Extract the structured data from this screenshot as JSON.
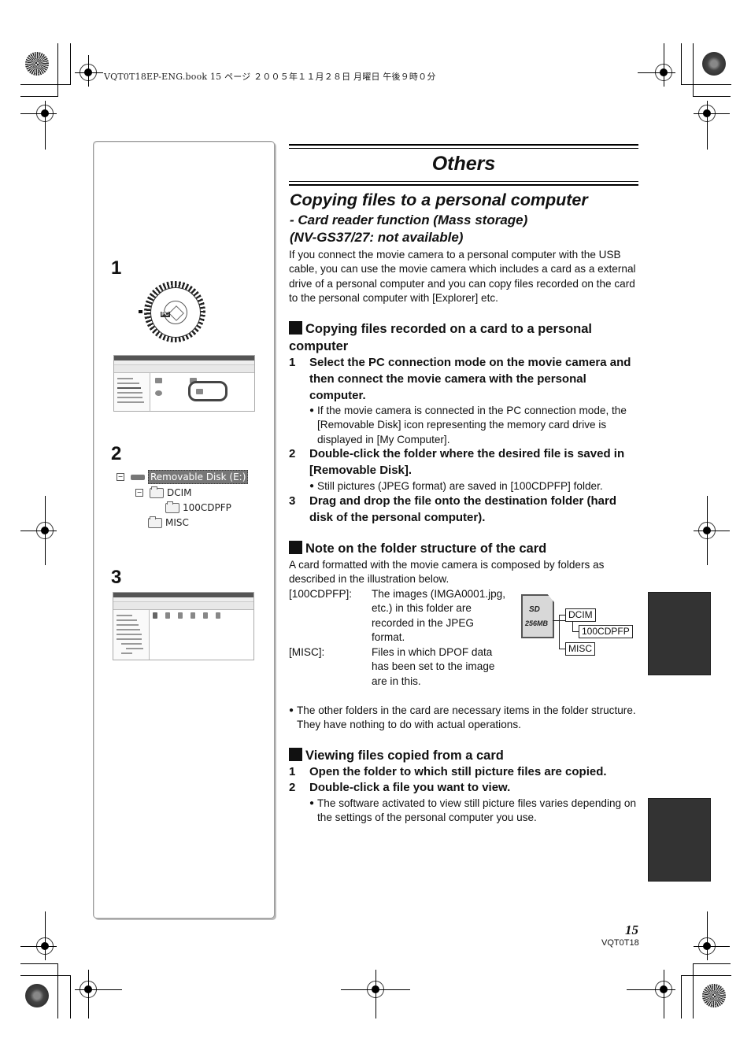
{
  "print_header": {
    "text": "VQT0T18EP-ENG.book  15 ページ  ２００５年１１月２８日  月曜日  午後９時０分"
  },
  "left_panel": {
    "steps": [
      {
        "number": "1",
        "illustration": "mode-dial-and-my-computer-window"
      },
      {
        "number": "2",
        "illustration": "removable-disk-folder-tree"
      },
      {
        "number": "3",
        "illustration": "explorer-drag-and-drop"
      }
    ],
    "dial": {
      "pc_label": "PC"
    },
    "tree": {
      "drive": "Removable Disk (E:)",
      "folders": [
        "DCIM",
        "100CDPFP",
        "MISC"
      ]
    }
  },
  "main": {
    "chapter_title": "Others",
    "title": "Copying files to a personal computer",
    "subtitle_line1": "- Card reader function (Mass storage)",
    "subtitle_line2": "(NV-GS37/27: not available)",
    "intro": "If you connect the movie camera to a personal computer with the USB cable, you can use the movie camera which includes a card as a external drive of a personal computer and you can copy files recorded on the card to the personal computer with [Explorer] etc.",
    "section1": {
      "heading": "Copying files recorded on a card to a personal computer",
      "steps": [
        {
          "num": "1",
          "text": "Select the PC connection mode on the movie camera and then connect the movie camera with the personal computer.",
          "note": "If the movie camera is connected in the PC connection mode, the [Removable Disk] icon representing the memory card drive is displayed in [My Computer]."
        },
        {
          "num": "2",
          "text": "Double-click the folder where the desired file is saved in [Removable Disk].",
          "note": "Still pictures (JPEG format) are saved in [100CDPFP] folder."
        },
        {
          "num": "3",
          "text": "Drag and drop the file onto the destination folder (hard disk of the personal computer)."
        }
      ]
    },
    "section2": {
      "heading": "Note on the folder structure of the card",
      "intro": "A card formatted with the movie camera is composed by folders as described in the illustration below.",
      "definitions": [
        {
          "term": "[100CDPFP]:",
          "desc": "The images (IMGA0001.jpg, etc.) in this folder are recorded in the JPEG format."
        },
        {
          "term": "[MISC]:",
          "desc": "Files in which DPOF data has been set to the image are in this."
        }
      ],
      "card": {
        "logo": "SD",
        "capacity": "256MB"
      },
      "diagram_folders": {
        "root1": "DCIM",
        "child": "100CDPFP",
        "root2": "MISC"
      },
      "note": "The other folders in the card are necessary items in the folder structure. They have nothing to do with actual operations."
    },
    "section3": {
      "heading": "Viewing files copied from a card",
      "steps": [
        {
          "num": "1",
          "text": "Open the folder to which still picture files are copied."
        },
        {
          "num": "2",
          "text": "Double-click a file you want to view.",
          "note": "The software activated to view still picture files varies depending on the settings of the personal computer you use."
        }
      ]
    },
    "bullet_glyph": "●"
  },
  "footer": {
    "page_number": "15",
    "doc_code": "VQT0T18"
  },
  "colors": {
    "ink": "#111111",
    "tab_gray": "#333333",
    "panel_border": "#999999"
  }
}
